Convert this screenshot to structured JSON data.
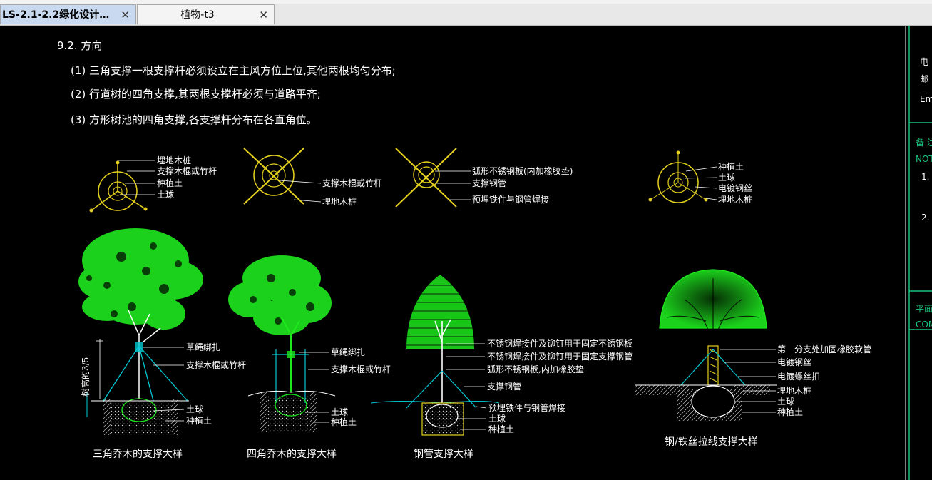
{
  "tabs": [
    {
      "label": "LS-2.1-2.2绿化设计…",
      "close": "✕"
    },
    {
      "label": "植物-t3",
      "close": "✕"
    }
  ],
  "section": {
    "heading": "9.2. 方向",
    "items": [
      "(1) 三角支撑一根支撑杆必须设立在主风方位上位,其他两根均匀分布;",
      "(2) 行道树的四角支撑,其两根支撑杆必须与道路平齐;",
      "(3) 方形树池的四角支撑,各支撑杆分布在各直角位。"
    ]
  },
  "plans": {
    "p1": [
      "埋地木桩",
      "支撑木棍或竹杆",
      "种植土",
      "土球"
    ],
    "p2": [
      "支撑木棍或竹杆",
      "埋地木桩"
    ],
    "p3": [
      "弧形不锈钢板(内加橡胶垫)",
      "支撑钢管",
      "预埋铁件与钢管焊接"
    ],
    "p4": [
      "种植土",
      "土球",
      "电镀钢丝",
      "埋地木桩"
    ]
  },
  "details": {
    "d1": {
      "labels": [
        "草绳绑扎",
        "支撑木棍或竹杆",
        "土球",
        "种植土"
      ],
      "dim": "树高的3/5",
      "caption": "三角乔木的支撑大样"
    },
    "d2": {
      "labels": [
        "草绳绑扎",
        "支撑木棍或竹杆",
        "土球",
        "种植土"
      ],
      "caption": "四角乔木的支撑大样"
    },
    "d3": {
      "labels": [
        "不锈钢焊接件及铆钉用于固定不锈钢板",
        "不锈钢焊接件及铆钉用于固定支撑钢管",
        "弧形不锈钢板,内加橡胶垫",
        "支撑钢管",
        "预埋铁件与钢管焊接",
        "土球",
        "种植土"
      ],
      "caption": "钢管支撑大样"
    },
    "d4": {
      "labels": [
        "第一分支处加固橡胶软管",
        "电镀钢丝",
        "电镀螺丝扣",
        "埋地木桩",
        "土球",
        "种植土"
      ],
      "caption": "钢/铁丝拉线支撑大样"
    }
  },
  "right_panel": {
    "line1": "电",
    "line2": "邮",
    "line3": "Em",
    "remark": "备 注",
    "notes": "NOTE",
    "n1": "1.",
    "n2": "2.",
    "plan": "平面",
    "comp": "COM"
  },
  "colors": {
    "canopy": "#1ee81e",
    "support": "#00c8d2",
    "plan": "#e6d21e",
    "text": "#ffffff",
    "frame": "#19c37d"
  }
}
